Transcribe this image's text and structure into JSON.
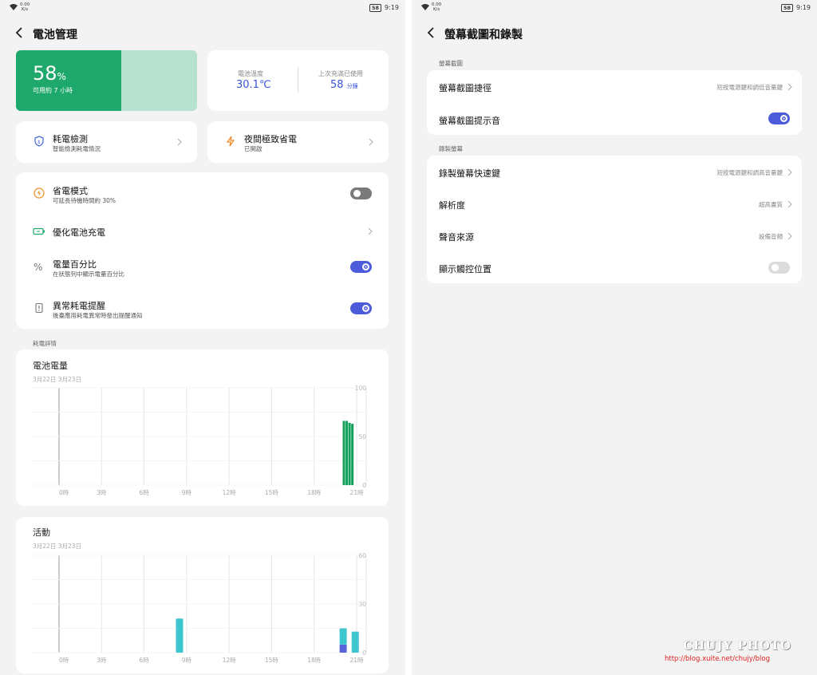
{
  "statusbar": {
    "speed_top": "0.00",
    "speed_bottom": "K/s",
    "battery": "58",
    "time": "9:19"
  },
  "battery_page": {
    "title": "電池管理",
    "battery_percent": "58",
    "battery_percent_unit": "%",
    "battery_level": 0.58,
    "remaining": "可用約 7 小時",
    "temp_label": "電池溫度",
    "temp_value": "30.1℃",
    "since_charge_label": "上次充滿已使用",
    "since_charge_value": "58",
    "since_charge_unit": "分鐘",
    "power_detect": {
      "title": "耗電檢測",
      "sub": "智能檢測耗電情況"
    },
    "night_saver": {
      "title": "夜間極致省電",
      "sub": "已開啟"
    },
    "power_saving": {
      "title": "省電模式",
      "sub": "可延長待機時間約 30%",
      "enabled": false
    },
    "optimize_charge": {
      "title": "優化電池充電"
    },
    "percent_display": {
      "title": "電量百分比",
      "sub": "在狀態列中顯示電量百分比",
      "enabled": true
    },
    "abnormal_alert": {
      "title": "異常耗電提醒",
      "sub": "後臺應用耗電異常時發出提醒通知",
      "enabled": true
    },
    "details_label": "耗電詳情"
  },
  "chart_data": [
    {
      "type": "bar",
      "title": "電池電量",
      "dates": "3月22日 3月23日",
      "x_ticks": [
        "0時",
        "3時",
        "6時",
        "9時",
        "12時",
        "15時",
        "18時",
        "21時"
      ],
      "y_ticks": [
        "100",
        "50",
        "0"
      ],
      "ylim": [
        0,
        100
      ],
      "grid": true,
      "x": [
        20.1,
        20.3,
        20.5,
        20.7
      ],
      "values": [
        66,
        66,
        64,
        63
      ],
      "colors": [
        "#12a05c"
      ]
    },
    {
      "type": "bar",
      "title": "活動",
      "dates": "3月22日 3月23日",
      "x_ticks": [
        "0時",
        "3時",
        "6時",
        "9時",
        "12時",
        "15時",
        "18時",
        "21時"
      ],
      "y_ticks": [
        "60",
        "30",
        "0"
      ],
      "ylim": [
        0,
        60
      ],
      "grid": true,
      "x": [
        8.5,
        20.05,
        20.9
      ],
      "series": [
        {
          "values": [
            21,
            10,
            13
          ],
          "color": "#3ec6cf"
        },
        {
          "values": [
            0,
            5,
            0
          ],
          "color": "#5a63d8"
        }
      ]
    }
  ],
  "screenshot_page": {
    "title": "螢幕截圖和錄製",
    "section1_label": "螢幕截圖",
    "shortcut": {
      "title": "螢幕截圖捷徑",
      "value": "短按電源鍵和調低音量鍵"
    },
    "sound": {
      "title": "螢幕截圖提示音",
      "enabled": true
    },
    "section2_label": "錄製螢幕",
    "record_shortcut": {
      "title": "錄製螢幕快速鍵",
      "value": "短按電源鍵和調高音量鍵"
    },
    "resolution": {
      "title": "解析度",
      "value": "超高畫質"
    },
    "audio_source": {
      "title": "聲音來源",
      "value": "設備音頻"
    },
    "touch_position": {
      "title": "顯示觸控位置",
      "enabled": false
    }
  },
  "watermark": {
    "title": "CHUJY PHOTO",
    "url": "http://blog.xuite.net/chujy/blog"
  },
  "colors": {
    "accent": "#4b5bd9",
    "battery_green": "#1ea86b",
    "activity_cyan": "#3ec6cf"
  },
  "icons": [
    "back-icon",
    "shield-icon",
    "bolt-icon",
    "battery-icon",
    "percent-icon",
    "alert-icon",
    "chevron-right-icon",
    "wifi-icon"
  ]
}
